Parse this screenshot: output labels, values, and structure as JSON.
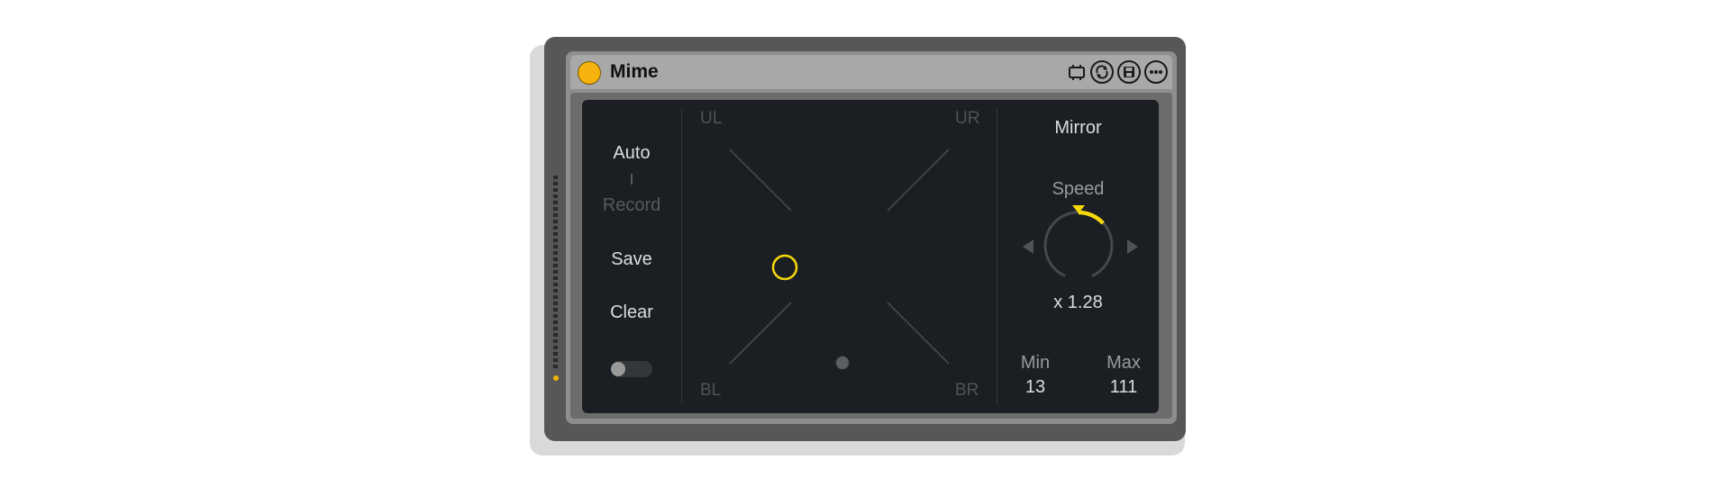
{
  "device": {
    "title": "Mime",
    "accent": "#f6b20d",
    "header_icons": [
      "clip-icon",
      "hot-swap-icon",
      "save-preset-icon",
      "more-options-icon"
    ]
  },
  "left_panel": {
    "auto_label": "Auto",
    "record_label": "Record",
    "save_label": "Save",
    "clear_label": "Clear"
  },
  "xy_pad": {
    "corners": {
      "ul": "UL",
      "ur": "UR",
      "bl": "BL",
      "br": "BR"
    },
    "highlight_color": "#f5d70a"
  },
  "right_panel": {
    "mirror_label": "Mirror",
    "speed_label": "Speed",
    "speed_value": "x 1.28",
    "min_label": "Min",
    "min_value": "13",
    "max_label": "Max",
    "max_value": "111"
  }
}
